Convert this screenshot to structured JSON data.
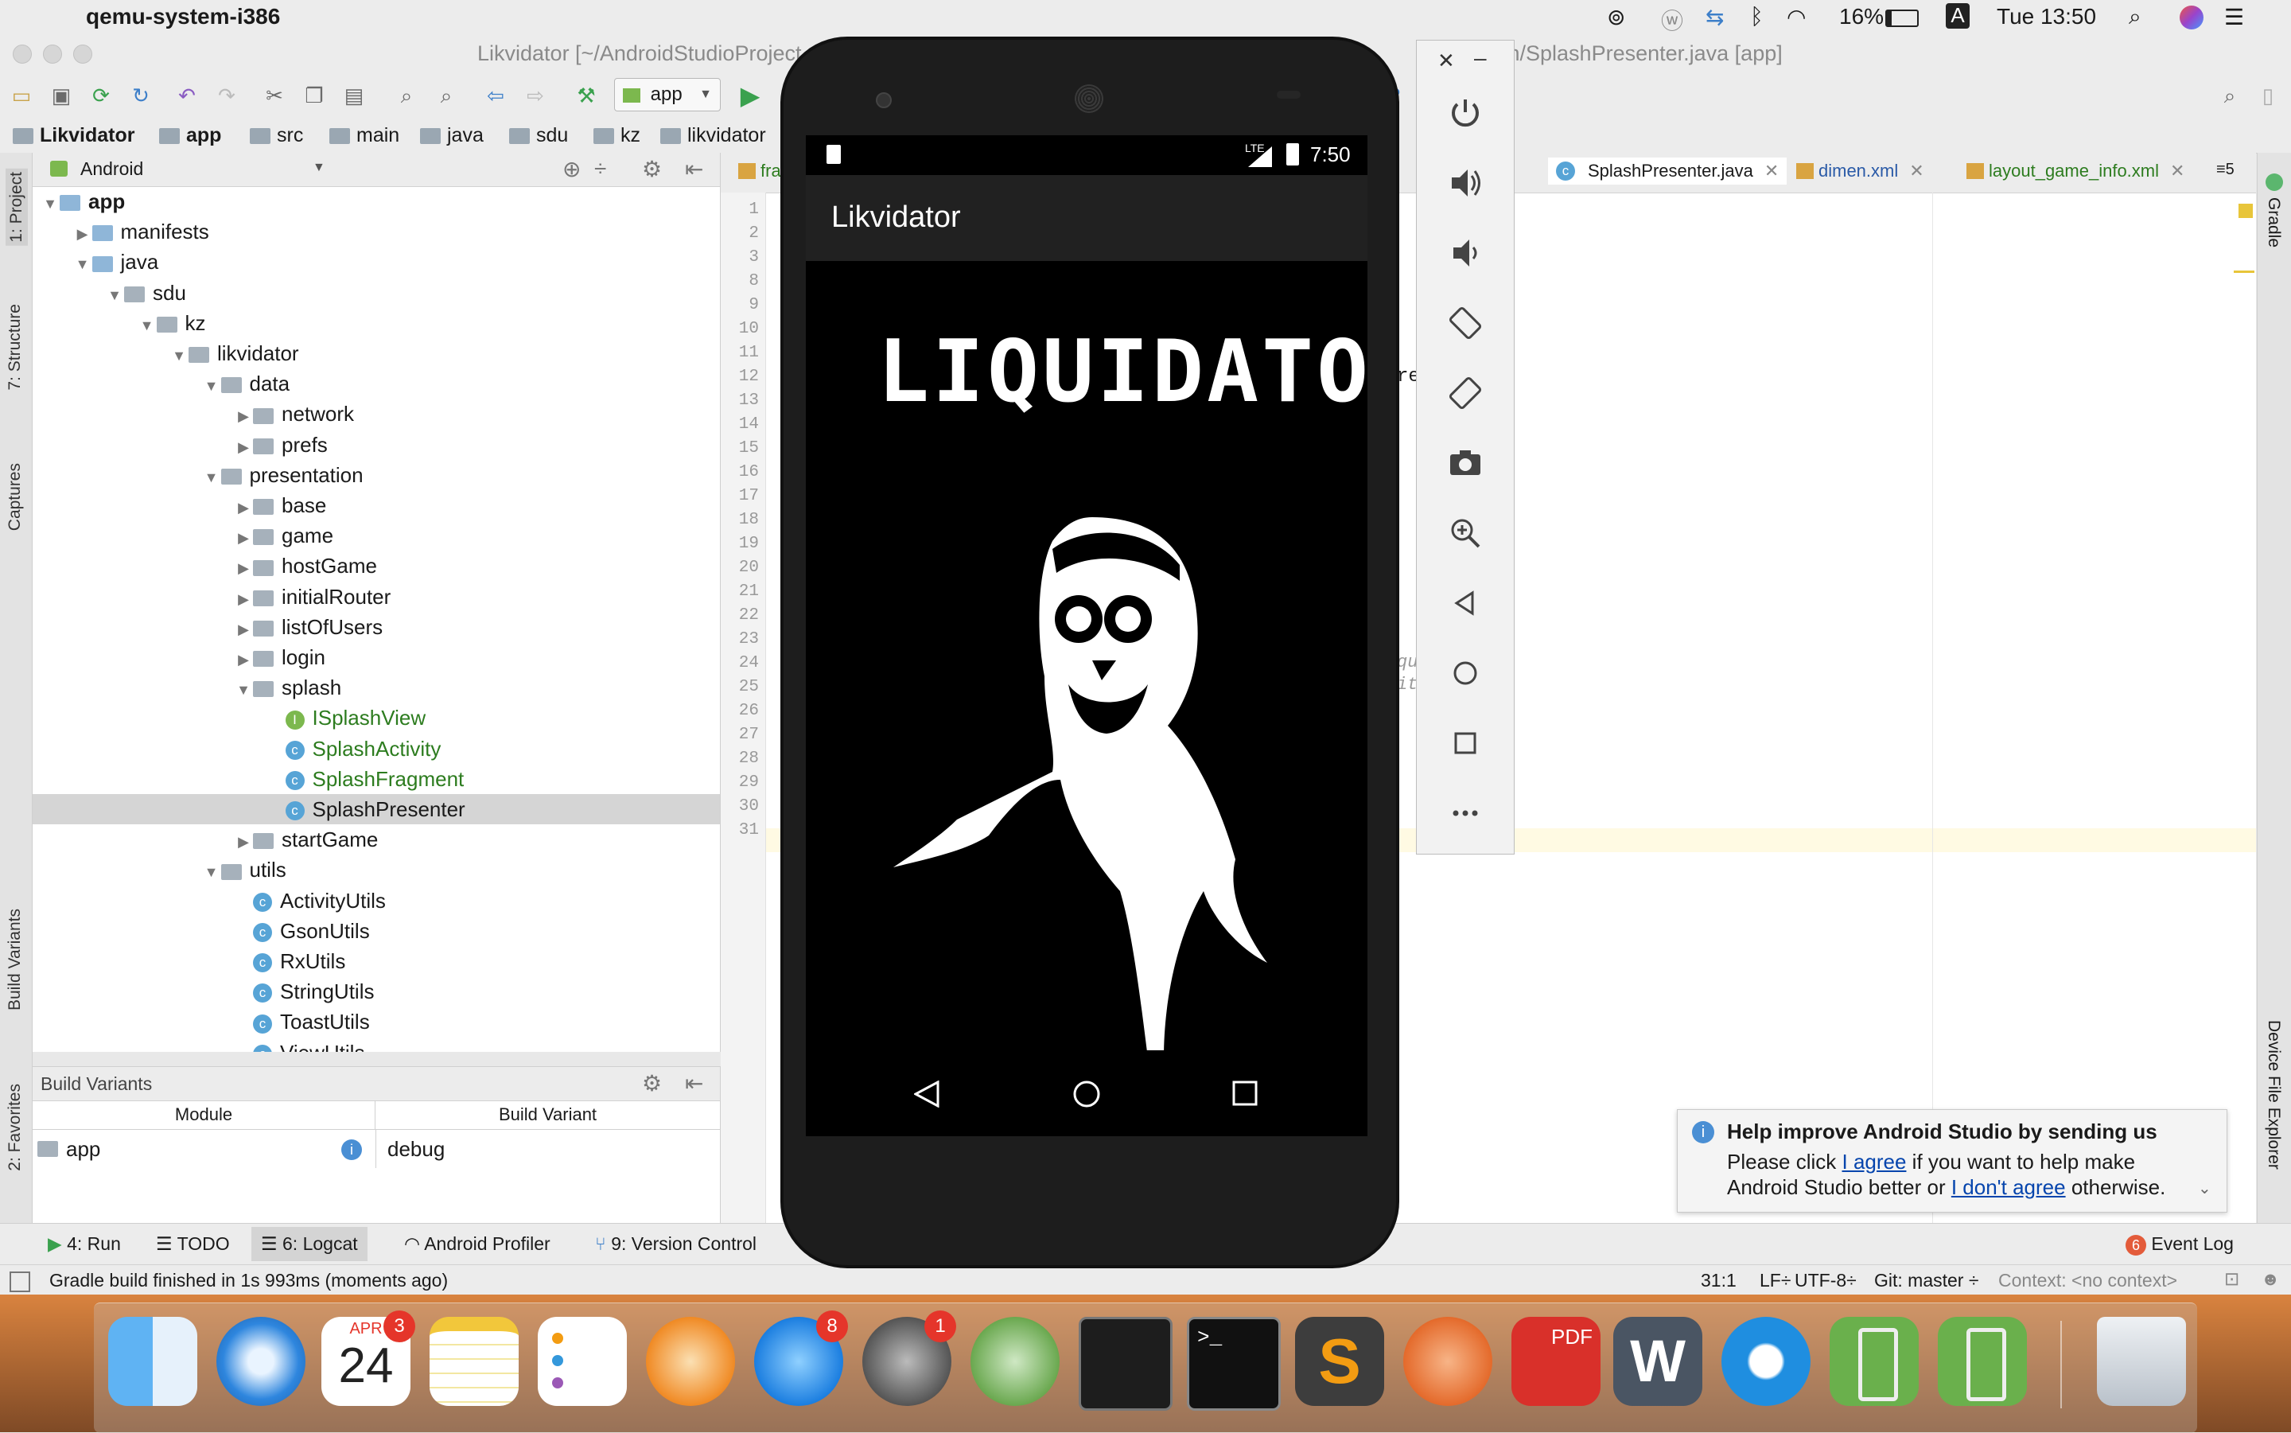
{
  "menubar": {
    "app_name": "qemu-system-i386",
    "battery": "16%",
    "input_source": "A",
    "clock": "Tue 13:50"
  },
  "window": {
    "title": "Likvidator [~/AndroidStudioProject",
    "title_tail": "sh/SplashPresenter.java [app]"
  },
  "toolbar": {
    "run_config": "app"
  },
  "breadcrumbs": [
    "Likvidator",
    "app",
    "src",
    "main",
    "java",
    "sdu",
    "kz",
    "likvidator"
  ],
  "left_tabs": [
    "1: Project",
    "7: Structure",
    "Captures",
    "Build Variants",
    "2: Favorites"
  ],
  "project": {
    "view_selector": "Android",
    "tree": [
      {
        "label": "app",
        "depth": 0,
        "arrow": "down",
        "icon": "folder-module"
      },
      {
        "label": "manifests",
        "depth": 1,
        "arrow": "right",
        "icon": "folder"
      },
      {
        "label": "java",
        "depth": 1,
        "arrow": "down",
        "icon": "folder"
      },
      {
        "label": "sdu",
        "depth": 2,
        "arrow": "down",
        "icon": "package"
      },
      {
        "label": "kz",
        "depth": 3,
        "arrow": "down",
        "icon": "package"
      },
      {
        "label": "likvidator",
        "depth": 4,
        "arrow": "down",
        "icon": "package"
      },
      {
        "label": "data",
        "depth": 5,
        "arrow": "down",
        "icon": "package"
      },
      {
        "label": "network",
        "depth": 6,
        "arrow": "right",
        "icon": "package"
      },
      {
        "label": "prefs",
        "depth": 6,
        "arrow": "right",
        "icon": "package"
      },
      {
        "label": "presentation",
        "depth": 5,
        "arrow": "down",
        "icon": "package"
      },
      {
        "label": "base",
        "depth": 6,
        "arrow": "right",
        "icon": "package"
      },
      {
        "label": "game",
        "depth": 6,
        "arrow": "right",
        "icon": "package"
      },
      {
        "label": "hostGame",
        "depth": 6,
        "arrow": "right",
        "icon": "package"
      },
      {
        "label": "initialRouter",
        "depth": 6,
        "arrow": "right",
        "icon": "package"
      },
      {
        "label": "listOfUsers",
        "depth": 6,
        "arrow": "right",
        "icon": "package"
      },
      {
        "label": "login",
        "depth": 6,
        "arrow": "right",
        "icon": "package"
      },
      {
        "label": "splash",
        "depth": 6,
        "arrow": "down",
        "icon": "package"
      },
      {
        "label": "ISplashView",
        "depth": 7,
        "arrow": "",
        "icon": "interface"
      },
      {
        "label": "SplashActivity",
        "depth": 7,
        "arrow": "",
        "icon": "class"
      },
      {
        "label": "SplashFragment",
        "depth": 7,
        "arrow": "",
        "icon": "class"
      },
      {
        "label": "SplashPresenter",
        "depth": 7,
        "arrow": "",
        "icon": "class"
      },
      {
        "label": "startGame",
        "depth": 6,
        "arrow": "right",
        "icon": "package"
      },
      {
        "label": "utils",
        "depth": 5,
        "arrow": "down",
        "icon": "package"
      },
      {
        "label": "ActivityUtils",
        "depth": 6,
        "arrow": "",
        "icon": "class"
      },
      {
        "label": "GsonUtils",
        "depth": 6,
        "arrow": "",
        "icon": "class"
      },
      {
        "label": "RxUtils",
        "depth": 6,
        "arrow": "",
        "icon": "class"
      },
      {
        "label": "StringUtils",
        "depth": 6,
        "arrow": "",
        "icon": "class"
      },
      {
        "label": "ToastUtils",
        "depth": 6,
        "arrow": "",
        "icon": "class"
      },
      {
        "label": "ViewUtils",
        "depth": 6,
        "arrow": "",
        "icon": "class"
      }
    ]
  },
  "build_variants": {
    "title": "Build Variants",
    "col_module": "Module",
    "col_variant": "Build Variant",
    "row_module": "app",
    "row_variant": "debug"
  },
  "editor": {
    "tabs": [
      {
        "label": "frag",
        "icon": "xml"
      },
      {
        "label": "SplashPresenter.java",
        "icon": "class",
        "active": true
      },
      {
        "label": "dimen.xml",
        "icon": "xml"
      },
      {
        "label": "layout_game_info.xml",
        "icon": "xml"
      }
    ],
    "tabs_overflow": "≡5",
    "line_numbers": [
      "1",
      "2",
      "3",
      "8",
      "9",
      "10",
      "11",
      "12",
      "13",
      "14",
      "15",
      "16",
      "17",
      "18",
      "19",
      "20",
      "21",
      "22",
      "23",
      "24",
      "25",
      "26",
      "27",
      "28",
      "29",
      "30",
      "31"
    ],
    "code_fragments": [
      "re",
      "qu",
      "it"
    ]
  },
  "right_tabs": [
    "Gradle",
    "Device File Explorer"
  ],
  "tool_tabs": [
    {
      "label": "4: Run"
    },
    {
      "label": "TODO"
    },
    {
      "label": "6: Logcat"
    },
    {
      "label": "Android Profiler"
    },
    {
      "label": "9: Version Control"
    }
  ],
  "event_log": {
    "label": "Event Log",
    "count": "6"
  },
  "status": {
    "message": "Gradle build finished in 1s 993ms (moments ago)",
    "position": "31:1",
    "line_sep": "LF÷",
    "encoding": "UTF-8÷",
    "vcs": "Git: master ÷",
    "context": "Context: <no context>"
  },
  "notification": {
    "title": "Help improve Android Studio by sending us",
    "line1_pre": "Please click ",
    "agree": "I agree",
    "line1_post": " if you want to help make",
    "line2_pre": "Android Studio better or ",
    "disagree": "I don't agree",
    "line2_post": " otherwise."
  },
  "phone": {
    "time": "7:50",
    "network": "LTE",
    "app_title": "Likvidator",
    "splash_text": "LIQUIDATOR"
  },
  "dock": {
    "calendar_month": "APR",
    "calendar_day": "24",
    "calendar_badge": "3",
    "appstore_badge": "8",
    "prefs_badge": "1",
    "pdf_label": "PDF"
  },
  "colors": {
    "chrome": "#ececec",
    "accent_blue": "#3d7fc9",
    "phone_bg": "#000000",
    "appbar": "#212121",
    "badge_red": "#e5352a"
  }
}
